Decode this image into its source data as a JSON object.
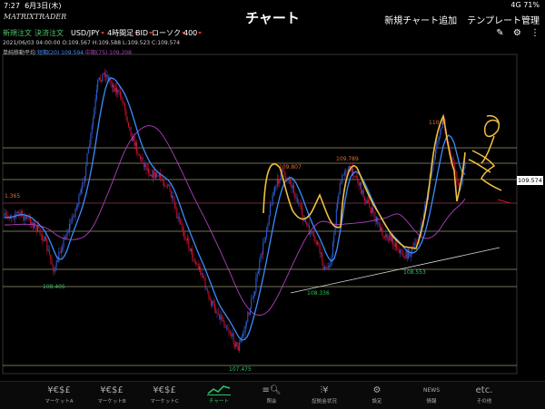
{
  "status": {
    "time": "7:27",
    "date": "6月3日(木)",
    "signal": "4G 71%"
  },
  "header": {
    "logo": "MATRIXTRADER",
    "title": "チャート",
    "add_chart": "新規チャート追加",
    "template": "テンプレート管理"
  },
  "toolbar": {
    "new_order": "新規注文",
    "close_order": "決済注文",
    "pair": "USD/JPY",
    "timeframe": "4時間足",
    "side": "BID",
    "candle": "ローソク",
    "count": "400"
  },
  "ohlc": "2021/06/03 04:00:00  O:109.567  H:109.588  L:109.523  C:109.574",
  "legend": {
    "label": "単純移動平均",
    "ma20": "短期(20) 109.594",
    "ma75": "中期(75) 109.208"
  },
  "price_tag": "109.574",
  "annotations": {
    "high_1": "110.1",
    "high_2": "109.789",
    "high_3": "109.807",
    "left_level": "1.365",
    "low_1": "108.405",
    "low_2": "108.336",
    "low_3": "108.553",
    "low_4": "107.475"
  },
  "colors": {
    "up": "#3060e0",
    "down": "#d01030",
    "ma20": "#3a8dff",
    "ma75": "#b040c0",
    "drawn_line": "#f0c040",
    "hline": "#e8e0a8",
    "high_label": "#e07030",
    "low_label": "#30c060"
  },
  "tabs": [
    {
      "label": "マーケットA",
      "icon": "¥€$£"
    },
    {
      "label": "マーケットB",
      "icon": "¥€$£"
    },
    {
      "label": "マーケットC",
      "icon": "¥€$£"
    },
    {
      "label": "チャート",
      "icon": "chart",
      "active": true
    },
    {
      "label": "照会",
      "icon": "search"
    },
    {
      "label": "証拠金状況",
      "icon": "bars-yen"
    },
    {
      "label": "設定",
      "icon": "gear"
    },
    {
      "label": "情報",
      "icon": "NEWS"
    },
    {
      "label": "その他",
      "icon": "etc."
    }
  ]
}
